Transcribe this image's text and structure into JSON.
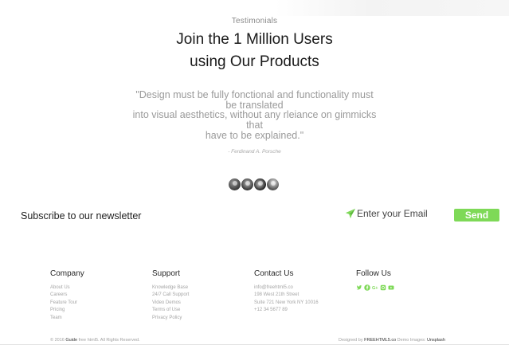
{
  "testimonials": {
    "section_label": "Testimonials",
    "headline_line1": "Join the 1 Million Users",
    "headline_line2": "using Our Products",
    "quote_lines": [
      "\"Design must be fully fonctional and functionality must",
      "be translated",
      "into visual aesthetics, without any rleiance on gimmicks",
      "that",
      "have to be explained.\""
    ],
    "author": "- Ferdinand A. Porsche",
    "avatars": [
      "avatar-1",
      "avatar-2",
      "avatar-3",
      "avatar-4"
    ]
  },
  "newsletter": {
    "title": "Subscribe to our newsletter",
    "email_placeholder": "Enter your Email",
    "send_label": "Send",
    "accent_color": "#7ed957"
  },
  "footer": {
    "company": {
      "title": "Company",
      "links": [
        "About Us",
        "Careers",
        "Feature Tour",
        "Pricing",
        "Team"
      ]
    },
    "support": {
      "title": "Support",
      "links": [
        "Knowledge Base",
        "24/7 Call Support",
        "Video Demos",
        "Terms of Use",
        "Privacy Policy"
      ]
    },
    "contact": {
      "title": "Contact Us",
      "lines": [
        "info@freehtml5.co",
        "198 West 21th Street",
        "Suite 721 New York NY 10016",
        "+12 34 5677 89"
      ]
    },
    "follow": {
      "title": "Follow Us",
      "icons": [
        "twitter-icon",
        "facebook-icon",
        "google-plus-icon",
        "instagram-icon",
        "youtube-icon"
      ],
      "icon_color": "#7ed957"
    },
    "copyright_prefix": "© 2016 ",
    "copyright_brand": "Guide",
    "copyright_suffix": " free html5. All Rights Reserved.",
    "credits_prefix": "Designed by ",
    "credits_link1": "FREEHTML5.co",
    "credits_mid": " Demo Images: ",
    "credits_link2": "Unsplash"
  }
}
